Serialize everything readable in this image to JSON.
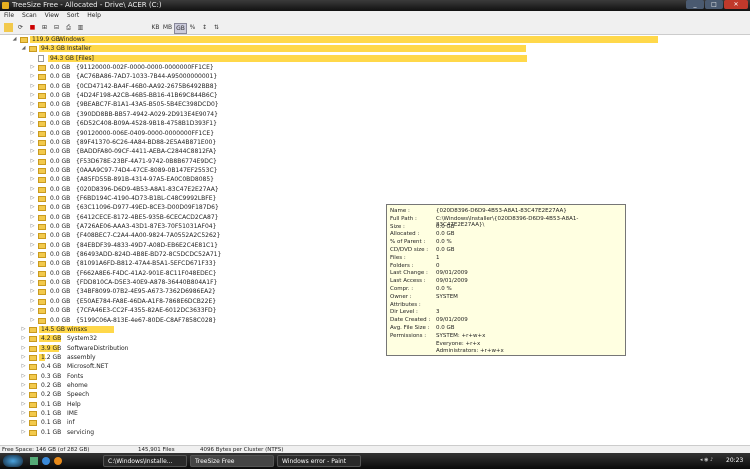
{
  "window": {
    "title": "TreeSize Free - Allocated - Drive\\ ACER (C:)"
  },
  "menu": [
    "File",
    "Scan",
    "View",
    "Sort",
    "Help"
  ],
  "toolbar": {
    "kb": "KB",
    "mb": "MB",
    "gb": "GB"
  },
  "tree": [
    {
      "size": "119.9 GB",
      "name": "Windows",
      "level": 0,
      "frac": 1.0,
      "open": true
    },
    {
      "size": "94.3 GB",
      "name": "Installer",
      "level": 1,
      "frac": 0.786,
      "open": true
    },
    {
      "size": "94.3 GB",
      "name": "[Files]",
      "level": 2,
      "frac": 0.786,
      "file": true
    },
    {
      "size": "0.0 GB",
      "name": "{91120000-002F-0000-0000-0000000FF1CE}",
      "level": 2
    },
    {
      "size": "0.0 GB",
      "name": "{AC76BA86-7AD7-1033-7B44-A95000000001}",
      "level": 2
    },
    {
      "size": "0.0 GB",
      "name": "{0CD47142-BA4F-46B0-AA92-2675B6492BB8}",
      "level": 2
    },
    {
      "size": "0.0 GB",
      "name": "{4D24F198-A2CB-46B5-BB16-41B69C844B6C}",
      "level": 2
    },
    {
      "size": "0.0 GB",
      "name": "{9BEABC7F-B1A1-43A5-B505-5B4EC398DCD0}",
      "level": 2
    },
    {
      "size": "0.0 GB",
      "name": "{390DD8BB-BB57-4942-A029-2D913E4E9074}",
      "level": 2
    },
    {
      "size": "0.0 GB",
      "name": "{6D52C408-B09A-4528-9B18-4758B1D393F1}",
      "level": 2
    },
    {
      "size": "0.0 GB",
      "name": "{90120000-006E-0409-0000-0000000FF1CE}",
      "level": 2
    },
    {
      "size": "0.0 GB",
      "name": "{89F41370-6C26-4A84-BD88-2E5A4B871E00}",
      "level": 2
    },
    {
      "size": "0.0 GB",
      "name": "{BADDFA80-09CF-4411-AEBA-C2844C8812FA}",
      "level": 2
    },
    {
      "size": "0.0 GB",
      "name": "{F53D678E-23BF-4A71-9742-0B8B6774E9DC}",
      "level": 2
    },
    {
      "size": "0.0 GB",
      "name": "{0AAA9C97-74D4-47CE-8089-0B147EF2553C}",
      "level": 2
    },
    {
      "size": "0.0 GB",
      "name": "{A85FD55B-891B-4314-97A5-EA0C0BD8085}",
      "level": 2
    },
    {
      "size": "0.0 GB",
      "name": "{020D8396-D6D9-4B53-A8A1-83C47E2E27AA}",
      "level": 2
    },
    {
      "size": "0.0 GB",
      "name": "{F6BD194C-4190-4D73-B1BL-C48C9992LBFE}",
      "level": 2
    },
    {
      "size": "0.0 GB",
      "name": "{63C11096-D977-49ED-8CE3-D00D09F187D6}",
      "level": 2
    },
    {
      "size": "0.0 GB",
      "name": "{6412CECE-8172-4BE5-935B-6CECACD2CA87}",
      "level": 2
    },
    {
      "size": "0.0 GB",
      "name": "{A726AE06-AAA3-43D1-87E3-70F51031AF04}",
      "level": 2
    },
    {
      "size": "0.0 GB",
      "name": "{F408BEC7-C2A4-4A00-9824-7A0552A2C5262}",
      "level": 2
    },
    {
      "size": "0.0 GB",
      "name": "{84EBDF39-4833-49D7-A08D-EB6E2C4E81C1}",
      "level": 2
    },
    {
      "size": "0.0 GB",
      "name": "{86493ADD-824D-4B8E-BD72-8C5DCDC52A71}",
      "level": 2
    },
    {
      "size": "0.0 GB",
      "name": "{81091A6FD-B812-47A4-B5A1-5EFCD671F33}",
      "level": 2
    },
    {
      "size": "0.0 GB",
      "name": "{F662A8E6-F4DC-41A2-901E-8C11F048EDEC}",
      "level": 2
    },
    {
      "size": "0.0 GB",
      "name": "{FDD810CA-D5E3-40E9-A878-36440B804A1F}",
      "level": 2
    },
    {
      "size": "0.0 GB",
      "name": "{34BF8099-07B2-4E95-A673-7362D6986EA2}",
      "level": 2
    },
    {
      "size": "0.0 GB",
      "name": "{E50AE784-FA8E-46DA-A1F8-7868E6DCB22E}",
      "level": 2
    },
    {
      "size": "0.0 GB",
      "name": "{7CFA46E3-CC2F-4355-82AE-6012DC3633FD}",
      "level": 2
    },
    {
      "size": "0.0 GB",
      "name": "{5199C06A-813E-4e67-80DE-C8AF7858C028}",
      "level": 2
    },
    {
      "size": "14.5 GB",
      "name": "winsxs",
      "level": 1,
      "frac": 0.121
    },
    {
      "size": "4.2 GB",
      "name": "System32",
      "level": 1,
      "frac": 0.035
    },
    {
      "size": "3.9 GB",
      "name": "SoftwareDistribution",
      "level": 1,
      "frac": 0.033
    },
    {
      "size": "1.2 GB",
      "name": "assembly",
      "level": 1,
      "frac": 0.01
    },
    {
      "size": "0.4 GB",
      "name": "Microsoft.NET",
      "level": 1
    },
    {
      "size": "0.3 GB",
      "name": "Fonts",
      "level": 1
    },
    {
      "size": "0.2 GB",
      "name": "ehome",
      "level": 1
    },
    {
      "size": "0.2 GB",
      "name": "Speech",
      "level": 1
    },
    {
      "size": "0.1 GB",
      "name": "Help",
      "level": 1
    },
    {
      "size": "0.1 GB",
      "name": "IME",
      "level": 1
    },
    {
      "size": "0.1 GB",
      "name": "inf",
      "level": 1
    },
    {
      "size": "0.1 GB",
      "name": "servicing",
      "level": 1
    }
  ],
  "tooltip": [
    {
      "label": "Name :",
      "value": "{020D8396-D6D9-4B53-A8A1-83C47E2E27AA}"
    },
    {
      "label": "Full Path :",
      "value": "C:\\Windows\\Installer\\{020D8396-D6D9-4B53-A8A1-83C47E2E27AA}\\"
    },
    {
      "label": "Size :",
      "value": "0.0 GB"
    },
    {
      "label": "Allocated :",
      "value": "0.0 GB"
    },
    {
      "label": "% of Parent :",
      "value": "0.0 %"
    },
    {
      "label": "CD/DVD size :",
      "value": "0.0 GB"
    },
    {
      "label": "Files :",
      "value": "1"
    },
    {
      "label": "Folders :",
      "value": "0"
    },
    {
      "label": "Last Change :",
      "value": "09/01/2009"
    },
    {
      "label": "Last Access :",
      "value": "09/01/2009"
    },
    {
      "label": "Compr. :",
      "value": "0.0 %"
    },
    {
      "label": "Owner :",
      "value": "SYSTEM"
    },
    {
      "label": "Attributes :",
      "value": ""
    },
    {
      "label": "Dir Level :",
      "value": "3"
    },
    {
      "label": "Date Created :",
      "value": "09/01/2009"
    },
    {
      "label": "Avg. File Size :",
      "value": "0.0 GB"
    },
    {
      "label": "Permissions :",
      "value": "SYSTEM: +r+w+x"
    },
    {
      "label": "",
      "value": "Everyone: +r+x"
    },
    {
      "label": "",
      "value": "Administrators: +r+w+x"
    }
  ],
  "status": {
    "free": "Free Space: 146 GB  (of 282 GB)",
    "files": "145,901  Files",
    "cluster": "4096 Bytes per Cluster (NTFS)"
  },
  "taskbar": {
    "tasks": [
      "C:\\Windows\\Installe...",
      "TreeSize Free",
      "Windows error - Paint"
    ],
    "clock": "20:23"
  },
  "colors": {
    "bar": "#ffd84a",
    "folder": "#f2c94c",
    "tooltip_bg": "#ffffe1"
  }
}
